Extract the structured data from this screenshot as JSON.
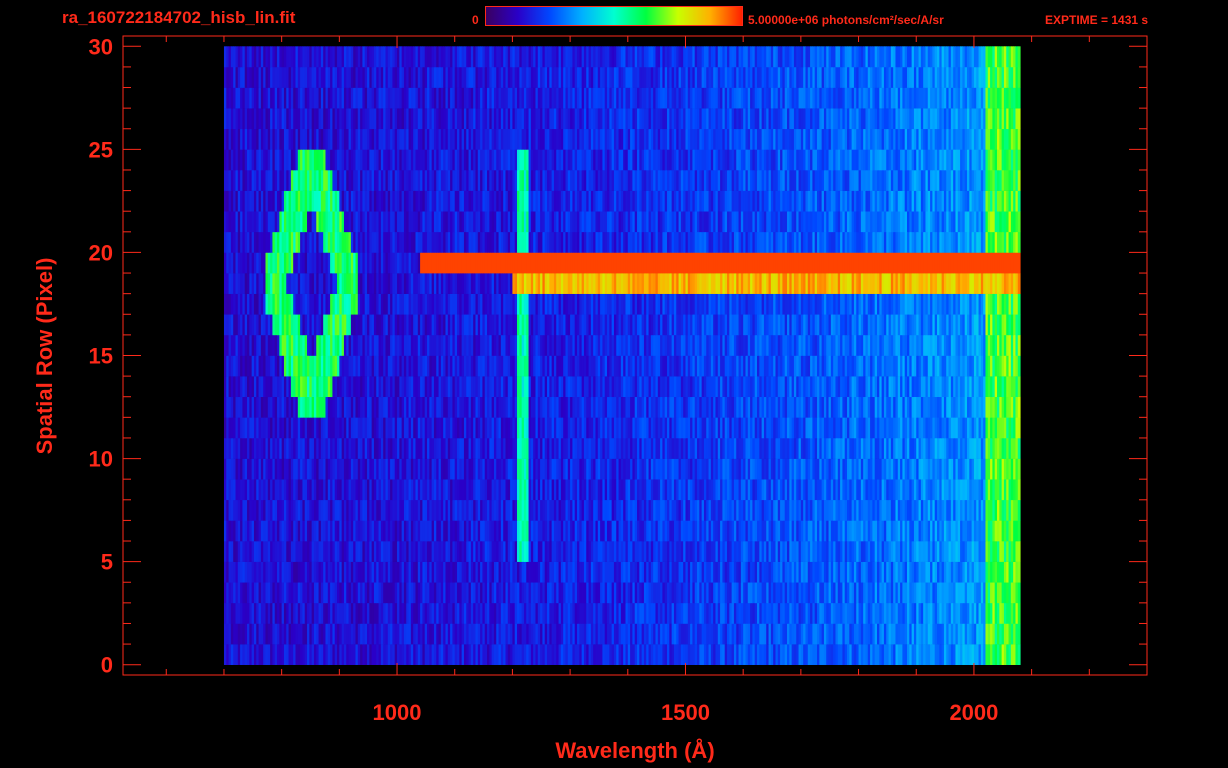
{
  "header": {
    "filename": "ra_160722184702_hisb_lin.fit",
    "colorbar_min": "0",
    "colorbar_max": "5.00000e+06 photons/cm²/sec/A/sr",
    "exptime": "EXPTIME = 1431 s"
  },
  "colors": {
    "axis": "#ff2a1a",
    "background": "#000000",
    "colormap": [
      "#3a0060",
      "#2a00c8",
      "#0048ff",
      "#00b0ff",
      "#00ffd0",
      "#00ff40",
      "#c8ff00",
      "#ffb000",
      "#ff2000"
    ]
  },
  "chart_data": {
    "type": "heatmap",
    "title": "ra_160722184702_hisb_lin.fit",
    "xlabel": "Wavelength (Å)",
    "ylabel": "Spatial Row (Pixel)",
    "xlim": [
      525,
      2300
    ],
    "ylim": [
      -0.5,
      30.5
    ],
    "x_ticks": [
      1000,
      1500,
      2000
    ],
    "y_ticks": [
      0,
      5,
      10,
      15,
      20,
      25,
      30
    ],
    "colorbar": {
      "min": 0,
      "max": 5000000,
      "unit": "photons/cm²/sec/A/sr",
      "scale": "linear"
    },
    "data_x_range": [
      700,
      2080
    ],
    "data_rows": 30,
    "features": [
      {
        "name": "bright spectrum row",
        "row": 19,
        "x_from": 1040,
        "x_to": 2080,
        "level": "saturated"
      },
      {
        "name": "bright spectrum row",
        "row": 18,
        "x_from": 1200,
        "x_to": 2080,
        "level": "high"
      },
      {
        "name": "vertical emission line",
        "x": 1216,
        "row_from": 5,
        "row_to": 24,
        "level": "medium"
      },
      {
        "name": "arc feature",
        "x_from": 770,
        "x_to": 930,
        "row_from": 12,
        "row_to": 24,
        "level": "medium-high"
      },
      {
        "name": "red edge band",
        "x_from": 2020,
        "x_to": 2080,
        "row_from": 0,
        "row_to": 30,
        "level": "medium-high"
      }
    ],
    "grid": false
  }
}
